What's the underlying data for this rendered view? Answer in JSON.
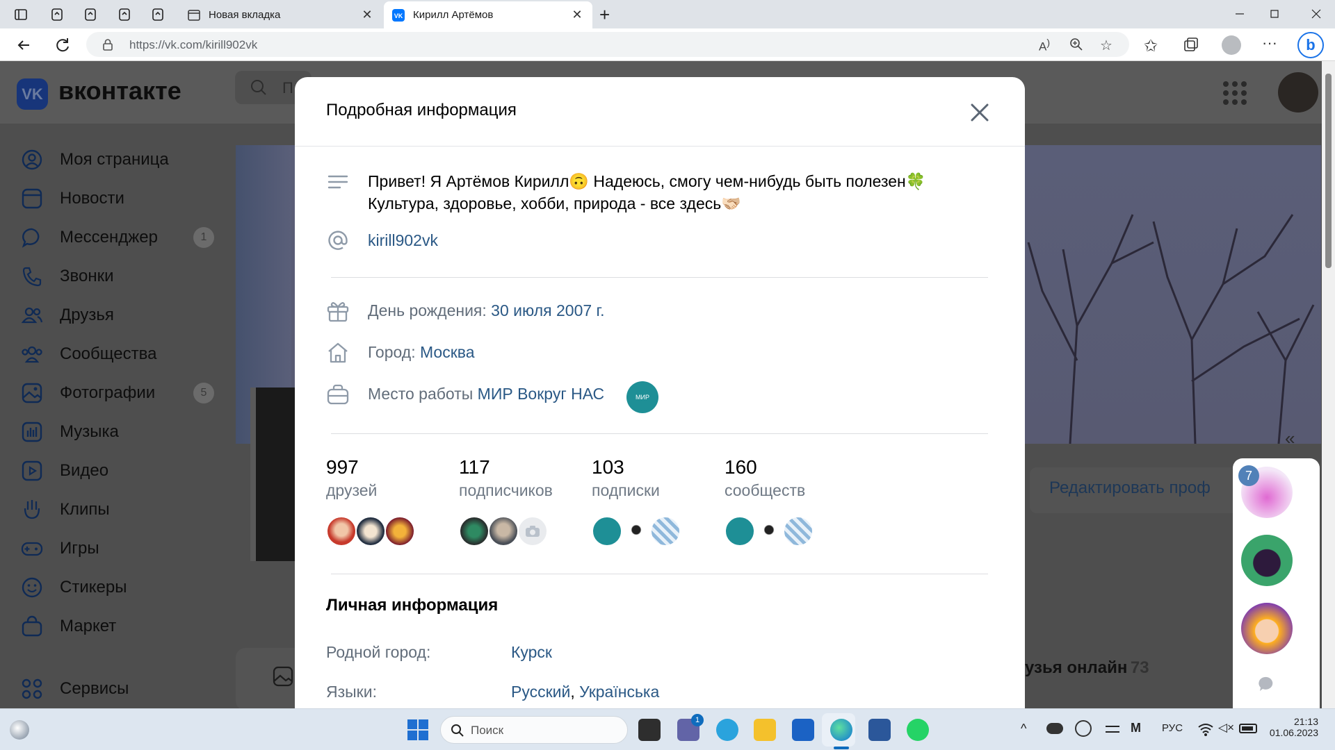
{
  "browser": {
    "tabs": [
      {
        "title": "Новая вкладка",
        "active": false
      },
      {
        "title": "Кирилл Артёмов",
        "active": true
      }
    ],
    "new_tab_label": "+",
    "url": "https://vk.com/kirill902vk"
  },
  "vk": {
    "logo_text": "вконтакте",
    "search_placeholder": "П",
    "nav": [
      {
        "label": "Моя страница",
        "icon": "user-circle-icon"
      },
      {
        "label": "Новости",
        "icon": "news-icon"
      },
      {
        "label": "Мессенджер",
        "icon": "chat-bubble-icon",
        "count": "1"
      },
      {
        "label": "Звонки",
        "icon": "phone-icon"
      },
      {
        "label": "Друзья",
        "icon": "friends-icon"
      },
      {
        "label": "Сообщества",
        "icon": "communities-icon"
      },
      {
        "label": "Фотографии",
        "icon": "photos-icon",
        "count": "5"
      },
      {
        "label": "Музыка",
        "icon": "music-icon"
      },
      {
        "label": "Видео",
        "icon": "video-icon"
      },
      {
        "label": "Клипы",
        "icon": "clips-icon"
      },
      {
        "label": "Игры",
        "icon": "gamepad-icon"
      },
      {
        "label": "Стикеры",
        "icon": "smile-icon"
      },
      {
        "label": "Маркет",
        "icon": "market-bag-icon"
      },
      {
        "label": "Сервисы",
        "icon": "services-grid-icon"
      }
    ],
    "edit_profile": "Редактировать проф",
    "friends_online_label": "узья онлайн",
    "friends_online_count": "73",
    "chat_badge": "7"
  },
  "modal": {
    "title": "Подробная информация",
    "status_line1": "Привет! Я Артёмов Кирилл🙃 Надеюсь, смогу чем-нибудь быть полезен🍀",
    "status_line2": "Культура, здоровье, хобби, природа - все здесь🫱🏻‍🫲🏼",
    "screen_name": "kirill902vk",
    "birthday_label": "День рождения:",
    "birthday_value": "30 июля 2007 г.",
    "city_label": "Город:",
    "city_value": "Москва",
    "work_label": "Место работы",
    "work_value": "МИР Вокруг НАС",
    "work_logo_text": "МИР",
    "stats": [
      {
        "value": "997",
        "label": "друзей"
      },
      {
        "value": "117",
        "label": "подписчиков"
      },
      {
        "value": "103",
        "label": "подписки"
      },
      {
        "value": "160",
        "label": "сообществ"
      }
    ],
    "personal_title": "Личная информация",
    "hometown_label": "Родной город:",
    "hometown_value": "Курск",
    "languages_label": "Языки:",
    "language_1": "Русский",
    "language_sep": ",",
    "language_2": "Українська"
  },
  "taskbar": {
    "search_placeholder": "Поиск",
    "chat_badge": "1",
    "lang": "РУС",
    "time": "21:13",
    "date": "01.06.2023"
  },
  "colors": {
    "vk_link": "#2a5885",
    "vk_blue": "#0077ff",
    "overlay_bg": "#4e4e4e"
  }
}
